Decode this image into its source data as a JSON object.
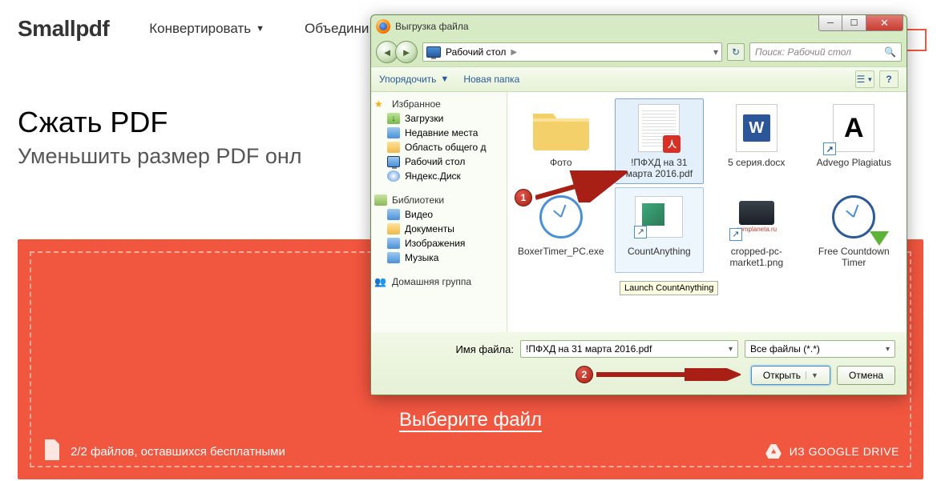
{
  "page": {
    "logo": "Smallpdf",
    "nav": [
      "Конвертировать",
      "Объедини"
    ],
    "title": "Сжать PDF",
    "subtitle": "Уменьшить размер PDF онл",
    "choose_file": "Выберите файл",
    "files_left": "2/2 файлов, оставшихся бесплатными",
    "from_drive": "ИЗ GOOGLE DRIVE"
  },
  "dialog": {
    "title": "Выгрузка файла",
    "crumb": "Рабочий стол",
    "search_placeholder": "Поиск: Рабочий стол",
    "organize": "Упорядочить",
    "new_folder": "Новая папка",
    "tree": {
      "favorites": "Избранное",
      "fav_items": [
        "Загрузки",
        "Недавние места",
        "Область общего д",
        "Рабочий стол",
        "Яндекс.Диск"
      ],
      "libraries": "Библиотеки",
      "lib_items": [
        "Видео",
        "Документы",
        "Изображения",
        "Музыка"
      ],
      "homegroup": "Домашняя группа"
    },
    "files": [
      {
        "name": "Фото"
      },
      {
        "name": "!ПФХД на 31 марта 2016.pdf"
      },
      {
        "name": "5 серия.docx"
      },
      {
        "name": "Advego Plagiatus"
      },
      {
        "name": "BoxerTimer_PC.exe"
      },
      {
        "name": "CountAnything"
      },
      {
        "name": "cropped-pc-market1.png"
      },
      {
        "name": "Free Countdown Timer"
      }
    ],
    "tooltip": "Launch CountAnything",
    "filename_label": "Имя файла:",
    "filename_value": "!ПФХД на 31 марта 2016.pdf",
    "filter": "Все файлы (*.*)",
    "open": "Открыть",
    "cancel": "Отмена"
  },
  "annotations": {
    "one": "1",
    "two": "2"
  }
}
